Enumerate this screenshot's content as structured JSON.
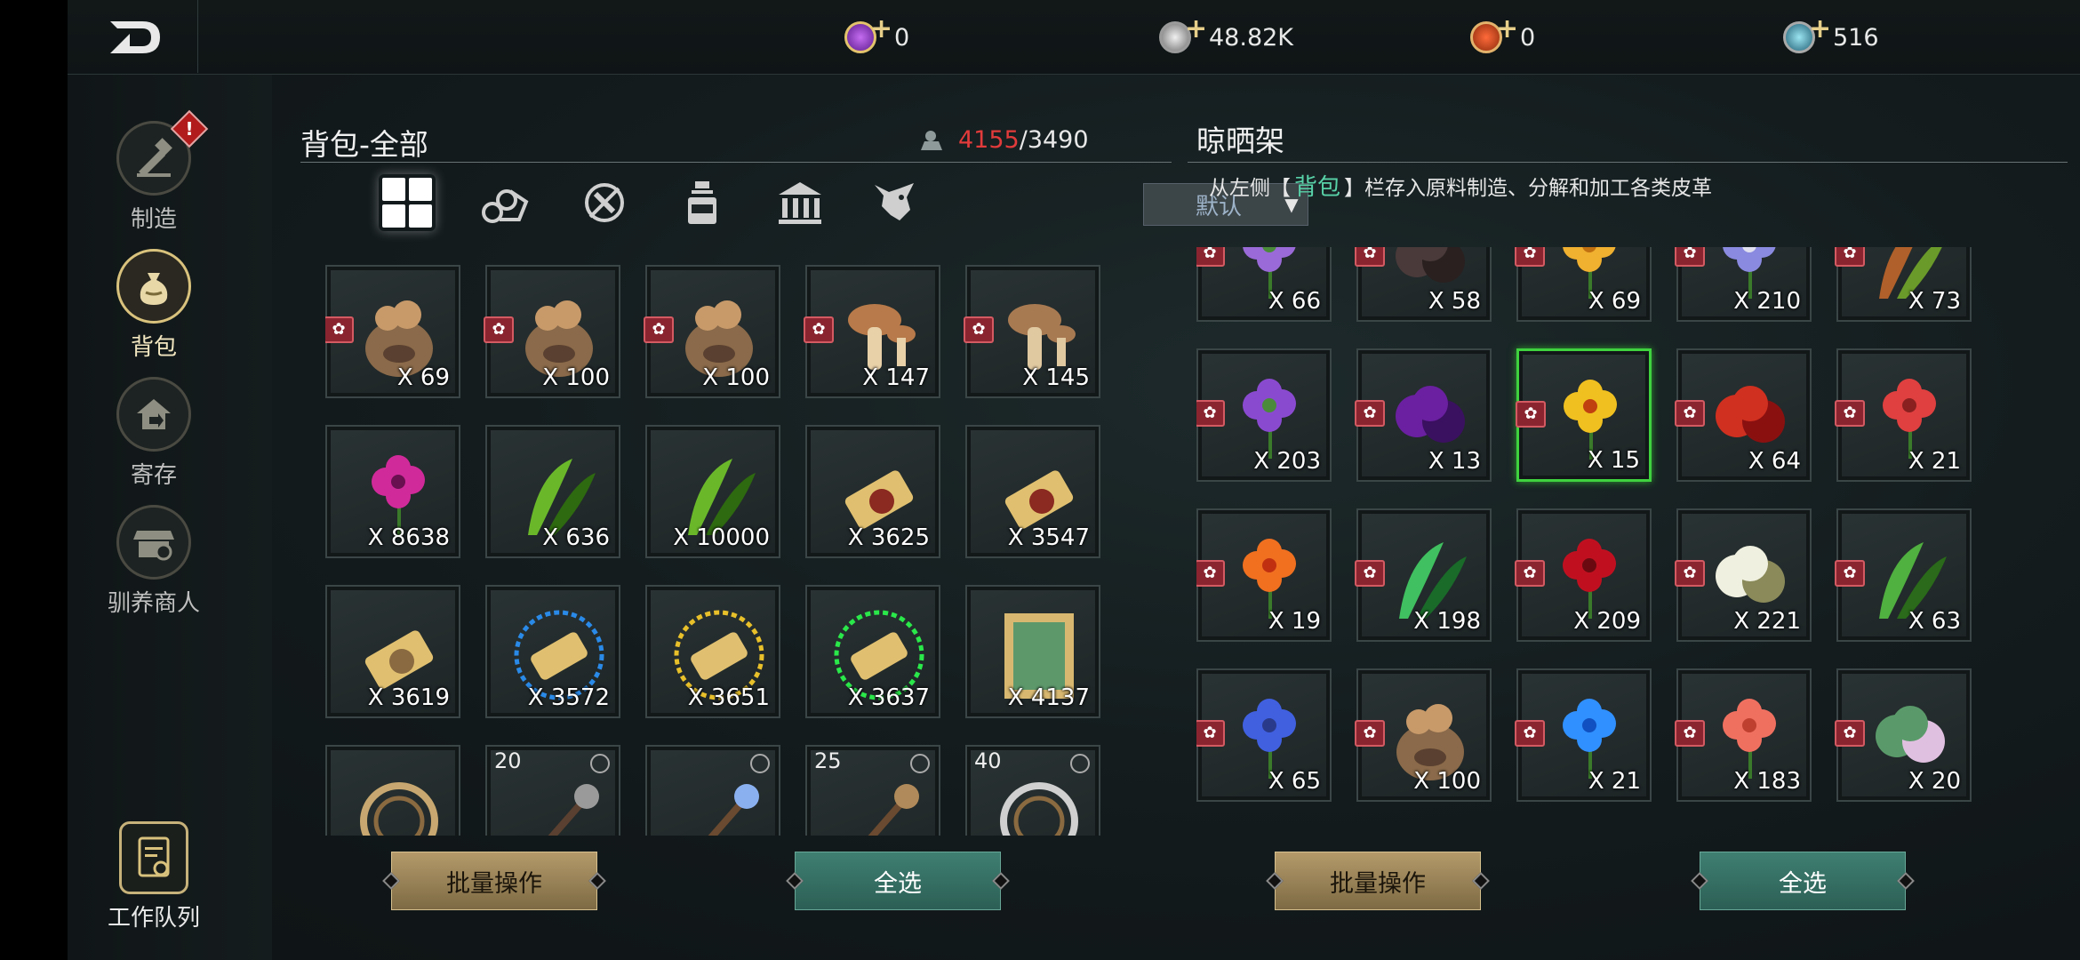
{
  "topbar": {
    "back_icon": "back-arrow-icon",
    "currencies": [
      {
        "icon": "purple-gem-icon",
        "color": "#9b3fd6",
        "value": "0"
      },
      {
        "icon": "silver-coin-icon",
        "color": "#c7c7c7",
        "value": "48.82K"
      },
      {
        "icon": "orange-coin-icon",
        "color": "#e08a2a",
        "value": "0"
      },
      {
        "icon": "teal-gem-icon",
        "color": "#4fb7c9",
        "value": "516"
      }
    ]
  },
  "sidebar": {
    "items": [
      {
        "label": "制造",
        "icon": "crafting-hammer-icon",
        "alert": "!"
      },
      {
        "label": "背包",
        "icon": "bag-icon"
      },
      {
        "label": "寄存",
        "icon": "storage-house-icon"
      },
      {
        "label": "驯养商人",
        "icon": "merchant-shop-icon"
      }
    ],
    "queue_label": "工作队列",
    "queue_icon": "work-queue-icon"
  },
  "backpack": {
    "title": "背包-全部",
    "capacity_used": "4155",
    "capacity_sep": "/",
    "capacity_max": "3490",
    "capacity_icon": "weight-icon",
    "tabs": [
      {
        "icon": "all-grid-icon"
      },
      {
        "icon": "wood-logs-icon"
      },
      {
        "icon": "no-weapon-icon"
      },
      {
        "icon": "potion-bottle-icon"
      },
      {
        "icon": "bank-building-icon"
      },
      {
        "icon": "pet-creature-icon"
      }
    ],
    "sort_label": "默认",
    "sort_arrow": "▼",
    "items": [
      {
        "qty": "X 69",
        "icon": "mushroom-sack-icon",
        "lvl": "",
        "gear": true
      },
      {
        "qty": "X 100",
        "icon": "mushroom-sack-icon",
        "lvl": "",
        "gear": true
      },
      {
        "qty": "X 100",
        "icon": "mushroom-sack-icon",
        "lvl": "",
        "gear": true
      },
      {
        "qty": "X 147",
        "icon": "mushroom-icon",
        "lvl": "",
        "gear": true
      },
      {
        "qty": "X 145",
        "icon": "mushroom-cluster-icon",
        "lvl": "",
        "gear": true
      },
      {
        "qty": "X 8638",
        "icon": "orchid-icon",
        "lvl": "",
        "gear": false
      },
      {
        "qty": "X 636",
        "icon": "grass-icon",
        "lvl": "",
        "gear": false
      },
      {
        "qty": "X 10000",
        "icon": "grass-icon",
        "lvl": "",
        "gear": false
      },
      {
        "qty": "X 3625",
        "icon": "scroll-seal-icon",
        "lvl": "",
        "gear": false
      },
      {
        "qty": "X 3547",
        "icon": "scroll-seal-icon",
        "lvl": "",
        "gear": false
      },
      {
        "qty": "X 3619",
        "icon": "scroll-icon",
        "lvl": "",
        "gear": false
      },
      {
        "qty": "X 3572",
        "icon": "blue-rune-scroll-icon",
        "lvl": "",
        "gear": false
      },
      {
        "qty": "X 3651",
        "icon": "gold-rune-scroll-icon",
        "lvl": "",
        "gear": false
      },
      {
        "qty": "X 3637",
        "icon": "green-rune-scroll-icon",
        "lvl": "",
        "gear": false
      },
      {
        "qty": "X 4137",
        "icon": "ancient-map-icon",
        "lvl": "",
        "gear": false
      },
      {
        "qty": "",
        "icon": "rope-coil-icon",
        "lvl": "",
        "gear": false
      },
      {
        "qty": "",
        "icon": "spiked-mace-icon",
        "lvl": "20",
        "gear": false,
        "link": true
      },
      {
        "qty": "",
        "icon": "crystal-staff-icon",
        "lvl": "",
        "gear": false,
        "link": true
      },
      {
        "qty": "",
        "icon": "spear-icon",
        "lvl": "25",
        "gear": false,
        "link": true
      },
      {
        "qty": "",
        "icon": "web-bow-icon",
        "lvl": "40",
        "gear": false,
        "link": true
      }
    ],
    "batch_button": "批量操作",
    "select_all_button": "全选"
  },
  "rack": {
    "title": "晾晒架",
    "hint_prefix": "从左侧【",
    "hint_keyword": "背包",
    "hint_suffix": "】栏存入原料制造、分解和加工各类皮革",
    "items": [
      {
        "qty": "X 66",
        "icon": "lavender-icon"
      },
      {
        "qty": "X 58",
        "icon": "truffle-icon"
      },
      {
        "qty": "X 69",
        "icon": "yellow-flower-icon"
      },
      {
        "qty": "X 210",
        "icon": "iris-icon"
      },
      {
        "qty": "X 73",
        "icon": "cattail-icon"
      },
      {
        "qty": "X 203",
        "icon": "lilac-icon"
      },
      {
        "qty": "X 13",
        "icon": "purple-berries-icon"
      },
      {
        "qty": "X 15",
        "icon": "yellow-bell-flower-icon",
        "selected": true
      },
      {
        "qty": "X 64",
        "icon": "red-moss-ball-icon"
      },
      {
        "qty": "X 21",
        "icon": "red-coral-flower-icon"
      },
      {
        "qty": "X 19",
        "icon": "orange-lily-icon"
      },
      {
        "qty": "X 198",
        "icon": "mint-leaf-icon"
      },
      {
        "qty": "X 209",
        "icon": "red-peony-icon"
      },
      {
        "qty": "X 221",
        "icon": "dandelion-icon"
      },
      {
        "qty": "X 63",
        "icon": "parsley-icon"
      },
      {
        "qty": "X 65",
        "icon": "cornflower-icon"
      },
      {
        "qty": "X 100",
        "icon": "mushroom-sack-icon"
      },
      {
        "qty": "X 21",
        "icon": "blue-glow-flower-icon"
      },
      {
        "qty": "X 183",
        "icon": "coral-flower-icon"
      },
      {
        "qty": "X 20",
        "icon": "cactus-flower-icon"
      }
    ],
    "batch_button": "批量操作",
    "select_all_button": "全选"
  },
  "colors": {
    "accent_red": "#e23b3b",
    "accent_teal": "#58d2a8",
    "selection_green": "#3fd23f"
  }
}
